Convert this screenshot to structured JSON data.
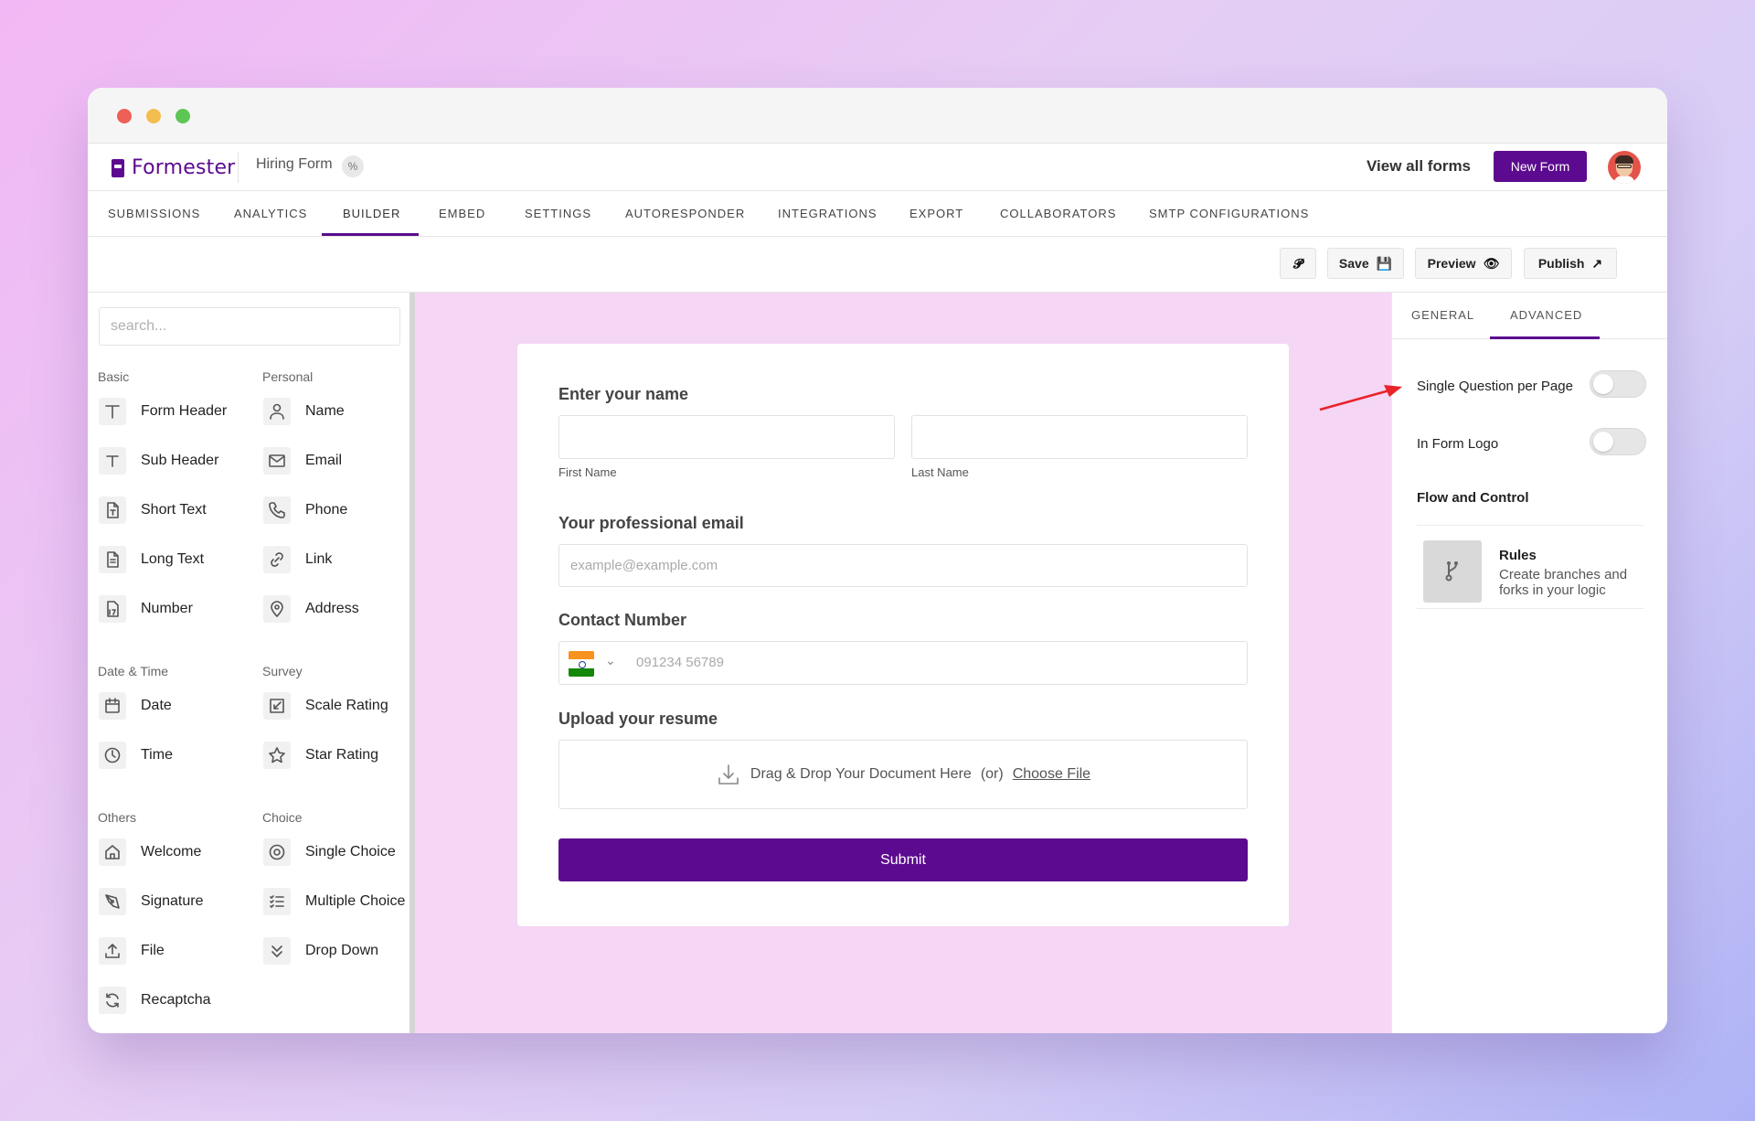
{
  "app": {
    "logo_text": "Formester",
    "form_name": "Hiring Form",
    "view_all": "View all forms",
    "new_form": "New Form"
  },
  "tabs": [
    {
      "label": "SUBMISSIONS"
    },
    {
      "label": "ANALYTICS"
    },
    {
      "label": "BUILDER",
      "active": true
    },
    {
      "label": "EMBED"
    },
    {
      "label": "SETTINGS"
    },
    {
      "label": "AUTORESPONDER"
    },
    {
      "label": "INTEGRATIONS"
    },
    {
      "label": "EXPORT"
    },
    {
      "label": "COLLABORATORS"
    },
    {
      "label": "SMTP CONFIGURATIONS"
    }
  ],
  "toolbar": {
    "save": "Save",
    "preview": "Preview",
    "publish": "Publish"
  },
  "sidebar": {
    "search_placeholder": "search...",
    "sections": {
      "basic": "Basic",
      "personal": "Personal",
      "datetime": "Date & Time",
      "survey": "Survey",
      "others": "Others",
      "choice": "Choice"
    },
    "items": {
      "form_header": "Form Header",
      "sub_header": "Sub Header",
      "short_text": "Short Text",
      "long_text": "Long Text",
      "number": "Number",
      "name": "Name",
      "email": "Email",
      "phone": "Phone",
      "link": "Link",
      "address": "Address",
      "date": "Date",
      "time": "Time",
      "scale_rating": "Scale Rating",
      "star_rating": "Star Rating",
      "welcome": "Welcome",
      "signature": "Signature",
      "file": "File",
      "recaptcha": "Recaptcha",
      "single_choice": "Single Choice",
      "multiple_choice": "Multiple Choice",
      "drop_down": "Drop Down"
    }
  },
  "form": {
    "name_label": "Enter your name",
    "first_name": "First Name",
    "last_name": "Last Name",
    "email_label": "Your professional email",
    "email_placeholder": "example@example.com",
    "contact_label": "Contact Number",
    "phone_placeholder": "091234 56789",
    "upload_label": "Upload your resume",
    "upload_text": "Drag & Drop Your Document Here",
    "upload_or": "(or)",
    "upload_choose": "Choose File",
    "submit": "Submit"
  },
  "panel": {
    "tabs": [
      "GENERAL",
      "ADVANCED"
    ],
    "active_tab": "ADVANCED",
    "single_question": "Single Question per Page",
    "single_question_on": false,
    "in_form_logo": "In Form Logo",
    "in_form_logo_on": false,
    "flow_title": "Flow and Control",
    "rules_title": "Rules",
    "rules_desc": "Create branches and forks in your logic"
  },
  "colors": {
    "brand": "#5c0a8f",
    "canvas_bg": "#f5d6f4",
    "annotation_arrow": "#e8232a"
  }
}
